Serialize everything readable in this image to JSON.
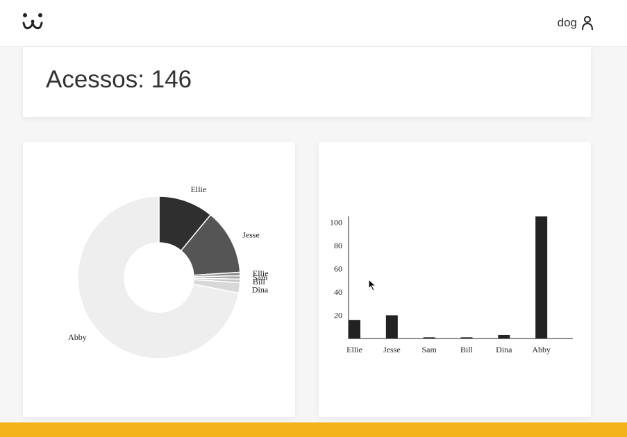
{
  "header": {
    "logo_icon": "dog-face-icon",
    "username": "dog",
    "user_icon": "user-icon"
  },
  "access": {
    "label": "Acessos: 146"
  },
  "colors": {
    "footer": "#f5b31a",
    "slices": [
      "#2f2f2f",
      "#555555",
      "#8a8a8a",
      "#a9a9a9",
      "#c6c6c6",
      "#d8d8d8",
      "#efeeef"
    ],
    "bars": "#222222"
  },
  "chart_data": [
    {
      "type": "pie",
      "donut": true,
      "labels": [
        "Ellie",
        "Jesse",
        "Ellie",
        "Sam",
        "Bill",
        "Dina",
        "Abby"
      ],
      "values": [
        16,
        19,
        1,
        1,
        1,
        3,
        105
      ]
    },
    {
      "type": "bar",
      "categories": [
        "Ellie",
        "Jesse",
        "Sam",
        "Bill",
        "Dina",
        "Abby"
      ],
      "values": [
        16,
        20,
        1,
        1,
        3,
        105
      ],
      "yticks": [
        20,
        40,
        60,
        80,
        100
      ],
      "ylim": [
        0,
        105
      ]
    }
  ]
}
